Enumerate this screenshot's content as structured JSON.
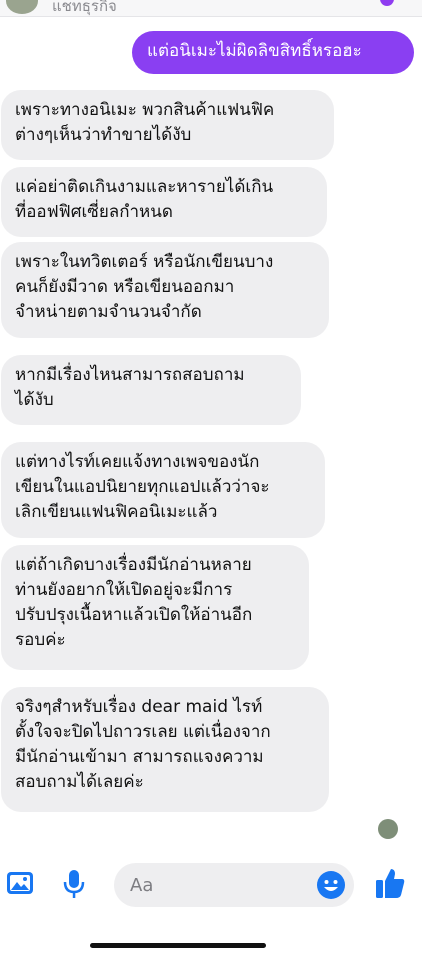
{
  "header": {
    "status_text": "แชทธุรกิจ",
    "accent_color": "#8f3cf0"
  },
  "messages": [
    {
      "direction": "outgoing",
      "text": "แต่อนิเมะไม่ผิดลิขสิทธิ์หรอฮะ"
    },
    {
      "direction": "incoming",
      "text": "เพราะทางอนิเมะ พวกสินค้าแฟนฟิค\nต่างๆเห็นว่าทำขายได้งับ"
    },
    {
      "direction": "incoming",
      "text": "แค่อย่าติดเกินงามและหารายได้เกิน\nที่ออฟฟิศเซี่ยลกำหนด"
    },
    {
      "direction": "incoming",
      "text": "เพราะในทวิตเตอร์ หรือนักเขียนบาง\nคนก็ยังมีวาด หรือเขียนออกมา\nจำหน่ายตามจำนวนจำกัด"
    },
    {
      "direction": "incoming",
      "text": "หากมีเรื่องไหนสามารถสอบถาม\nได้งับ"
    },
    {
      "direction": "incoming",
      "text": "แต่ทางไรท์เคยแจ้งทางเพจของนัก\nเขียนในแอปนิยายทุกแอปแล้วว่าจะ\nเลิกเขียนแฟนฟิคอนิเมะแล้ว"
    },
    {
      "direction": "incoming",
      "text": "แต่ถ้าเกิดบางเรื่องมีนักอ่านหลาย\nท่านยังอยากให้เปิดอยู่จะมีการ\nปรับปรุงเนื้อหาแล้วเปิดให้อ่านอีก\nรอบค่ะ"
    },
    {
      "direction": "incoming",
      "text": "จริงๆสำหรับเรื่อง dear maid ไรท์\nตั้งใจจะปิดไปถาวรเลย แต่เนื่องจาก\nมีนักอ่านเข้ามา สามารถแจงความ\nสอบถามได้เลยค่ะ"
    }
  ],
  "composer": {
    "placeholder": "Aa",
    "icons": [
      "gallery-icon",
      "microphone-icon",
      "emoji-icon",
      "thumbs-up-icon"
    ],
    "icon_color": "#1877f2"
  },
  "colors": {
    "outgoing_bubble": "#8a3ff2",
    "incoming_bubble": "#eeeef0"
  }
}
